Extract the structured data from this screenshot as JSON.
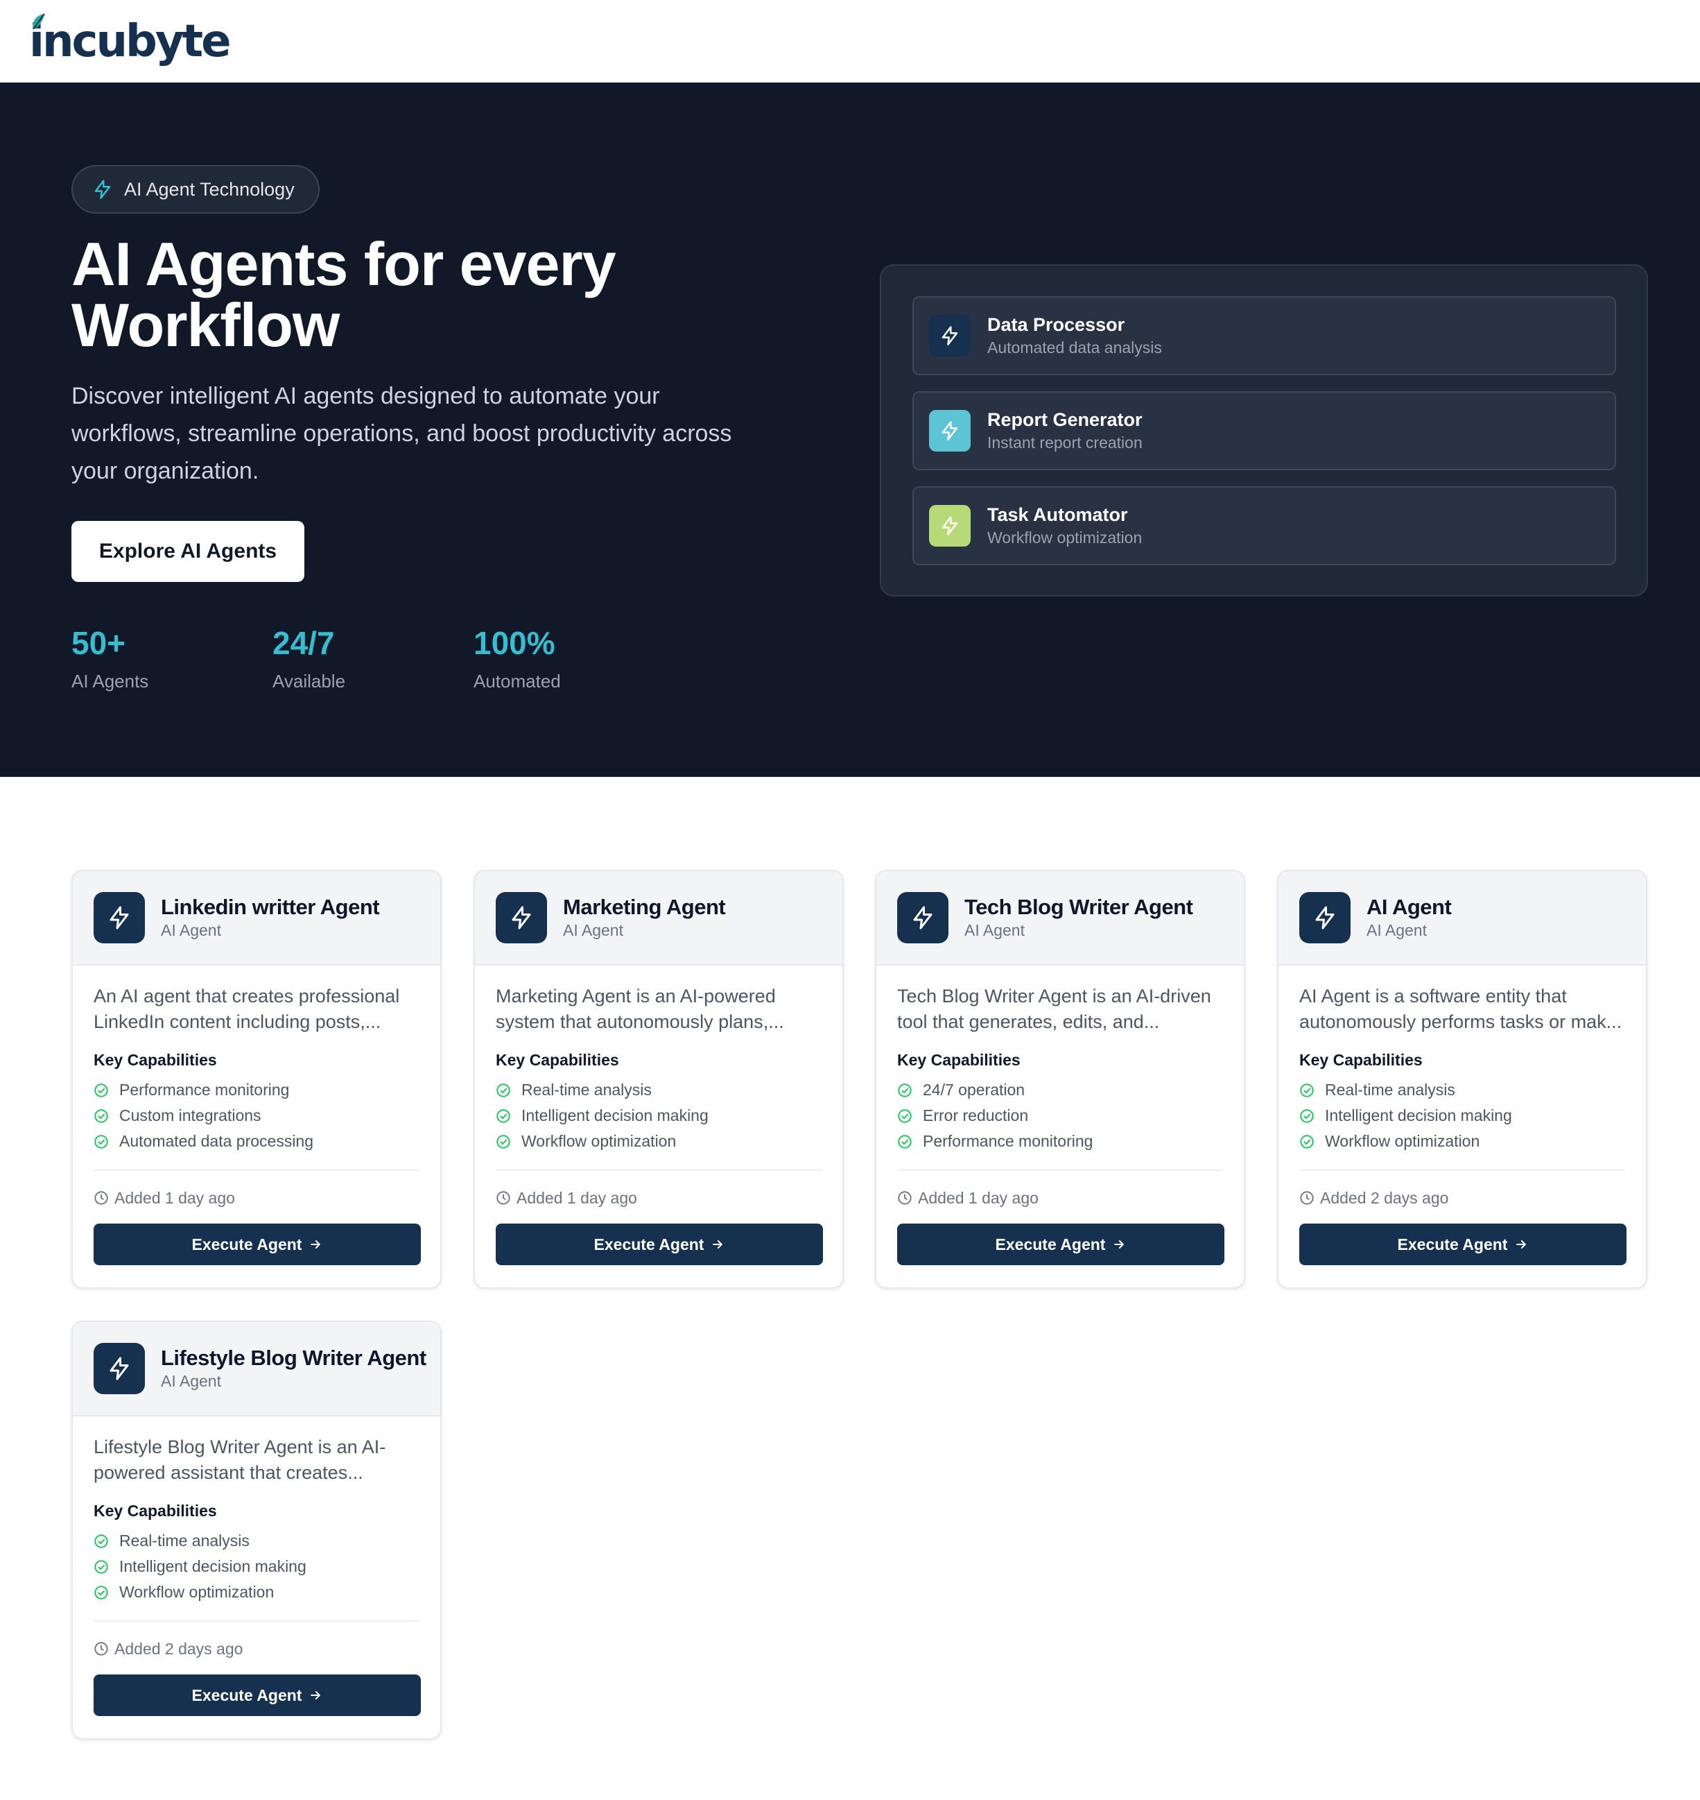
{
  "brand": {
    "name": "incubyte"
  },
  "hero": {
    "badge": "AI Agent Technology",
    "title": "AI Agents for every Workflow",
    "description": "Discover intelligent AI agents designed to automate your workflows, streamline operations, and boost productivity across your organization.",
    "cta": "Explore AI Agents",
    "stats": [
      {
        "value": "50+",
        "label": "AI Agents"
      },
      {
        "value": "24/7",
        "label": "Available"
      },
      {
        "value": "100%",
        "label": "Automated"
      }
    ],
    "preview": [
      {
        "title": "Data Processor",
        "subtitle": "Automated data analysis",
        "icon": "bolt-icon",
        "color": "#16304f"
      },
      {
        "title": "Report Generator",
        "subtitle": "Instant report creation",
        "icon": "bolt-icon",
        "color": "#5cc4d4"
      },
      {
        "title": "Task Automator",
        "subtitle": "Workflow optimization",
        "icon": "bolt-icon",
        "color": "#b8d977"
      }
    ]
  },
  "capabilities_heading": "Key Capabilities",
  "execute_label": "Execute Agent",
  "agents": [
    {
      "name": "Linkedin writter Agent",
      "type": "AI Agent",
      "description": "An AI agent that creates professional LinkedIn content including posts,...",
      "capabilities": [
        "Performance monitoring",
        "Custom integrations",
        "Automated data processing"
      ],
      "added": "Added 1 day ago"
    },
    {
      "name": "Marketing Agent",
      "type": "AI Agent",
      "description": "Marketing Agent is an AI-powered system that autonomously plans,...",
      "capabilities": [
        "Real-time analysis",
        "Intelligent decision making",
        "Workflow optimization"
      ],
      "added": "Added 1 day ago"
    },
    {
      "name": "Tech Blog Writer Agent",
      "type": "AI Agent",
      "description": "Tech Blog Writer Agent is an AI-driven tool that generates, edits, and...",
      "capabilities": [
        "24/7 operation",
        "Error reduction",
        "Performance monitoring"
      ],
      "added": "Added 1 day ago"
    },
    {
      "name": "AI Agent",
      "type": "AI Agent",
      "description": "AI Agent is a software entity that autonomously performs tasks or mak...",
      "capabilities": [
        "Real-time analysis",
        "Intelligent decision making",
        "Workflow optimization"
      ],
      "added": "Added 2 days ago"
    },
    {
      "name": "Lifestyle Blog Writer Agent",
      "type": "AI Agent",
      "description": "Lifestyle Blog Writer Agent is an AI-powered assistant that creates...",
      "capabilities": [
        "Real-time analysis",
        "Intelligent decision making",
        "Workflow optimization"
      ],
      "added": "Added 2 days ago"
    }
  ],
  "colors": {
    "hero_bg": "#111827",
    "panel_bg": "#1f2937",
    "accent_teal": "#38bdd0",
    "navy": "#16304f",
    "check_green": "#22c55e"
  }
}
